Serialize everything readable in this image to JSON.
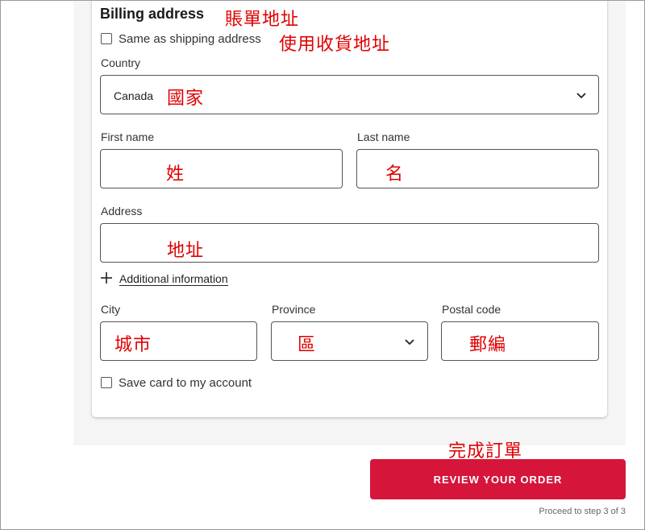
{
  "billing": {
    "heading": "Billing address",
    "same_as_shipping": "Same as shipping address",
    "country_label": "Country",
    "country_value": "Canada",
    "first_name_label": "First name",
    "last_name_label": "Last name",
    "address_label": "Address",
    "additional_info": "Additional information",
    "city_label": "City",
    "province_label": "Province",
    "postal_code_label": "Postal code",
    "save_card": "Save card to my account"
  },
  "annotations": {
    "billing_address": "賬單地址",
    "use_shipping": "使用收貨地址",
    "country": "國家",
    "first_name": "姓",
    "last_name": "名",
    "address": "地址",
    "city": "城市",
    "province": "區",
    "postal_code": "郵編",
    "complete_order": "完成訂單"
  },
  "actions": {
    "review_button": "REVIEW YOUR ORDER",
    "step_note": "Proceed to step 3 of 3"
  },
  "colors": {
    "accent": "#d5163a",
    "annotation": "#e00000"
  },
  "icons": {
    "dropdown": "chevron-down-icon",
    "expand": "plus-icon"
  }
}
